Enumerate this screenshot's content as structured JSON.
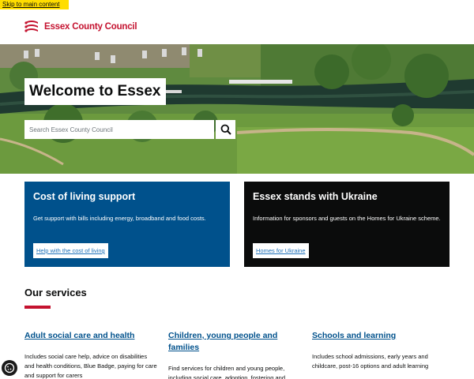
{
  "skip_link": "Skip to main content",
  "header": {
    "logo_text": "Essex County Council",
    "brand_color": "#c4122f"
  },
  "hero": {
    "title": "Welcome to Essex",
    "search_placeholder": "Search Essex County Council",
    "search_icon": "search-icon"
  },
  "cards": [
    {
      "title": "Cost of living support",
      "text": "Get support with bills including energy, broadband and food costs.",
      "link": "Help with the cost of living",
      "color": "#00518c"
    },
    {
      "title": "Essex stands with Ukraine",
      "text": "Information for sponsors and guests on the Homes for Ukraine scheme.",
      "link": "Homes for Ukraine",
      "color": "#0b0c0c"
    }
  ],
  "services": {
    "title": "Our services",
    "items": [
      {
        "title": "Adult social care and health",
        "desc": "Includes social care help, advice on disabilities and health conditions, Blue Badge, paying for care and support for carers"
      },
      {
        "title": "Children, young people and families",
        "desc": "Find services for children and young people, including social care, adoption, fostering and"
      },
      {
        "title": "Schools and learning",
        "desc": "Includes school admissions, early years and childcare, post-16 options and adult learning"
      }
    ]
  },
  "cookie_icon": "cookie-settings-icon"
}
